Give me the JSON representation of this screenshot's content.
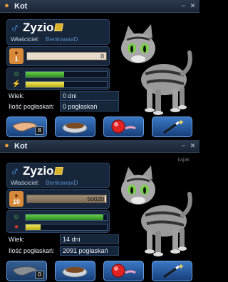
{
  "windows": [
    {
      "title": "Kot",
      "pet": {
        "gender_symbol": "♂",
        "name": "Zyzio",
        "owner_label": "Właściciel:",
        "owner": "BenkowaxD",
        "level": "1",
        "xp_value": "0",
        "xp_fraction": 0.0,
        "happiness_fraction": 0.47,
        "energy_fraction": 0.47
      },
      "info": {
        "age_label": "Wiek:",
        "age": "0 dni",
        "pets_label": "Ilość pogłaskań:",
        "pets": "0 pogłaskań"
      },
      "actions": {
        "stroke_count": "8",
        "stroke_disabled": false
      }
    },
    {
      "title": "Kot",
      "pet": {
        "gender_symbol": "♂",
        "name": "Zyzio",
        "owner_label": "Właściciel:",
        "owner": "BenkowaxD",
        "level": "10",
        "xp_value": "50020",
        "xp_fraction": 0.98,
        "happiness_fraction": 0.96,
        "energy_fraction": 0.18
      },
      "info": {
        "age_label": "Wiek:",
        "age": "14 dni",
        "pets_label": "Ilość pogłaskań:",
        "pets": "2091 pogłaskań"
      },
      "actions": {
        "stroke_count": "0",
        "stroke_disabled": true
      },
      "watermark": "kajak"
    }
  ],
  "icons": [
    "paw-icon",
    "minimize-icon",
    "close-icon",
    "male-gender-icon",
    "edit-icon",
    "level-paw-badge-icon",
    "smiley-icon",
    "lightning-icon",
    "apple-icon",
    "hand-stroke-icon",
    "food-bowl-icon",
    "ball-toy-icon",
    "magic-wand-icon"
  ],
  "colors": {
    "panel_bg": "#17263a",
    "button_blue": "#2a5ca0",
    "happiness": "#4cb83a",
    "energy": "#e0d83a",
    "gender_blue": "#4a9ce8",
    "level_orange": "#d88a3a"
  }
}
